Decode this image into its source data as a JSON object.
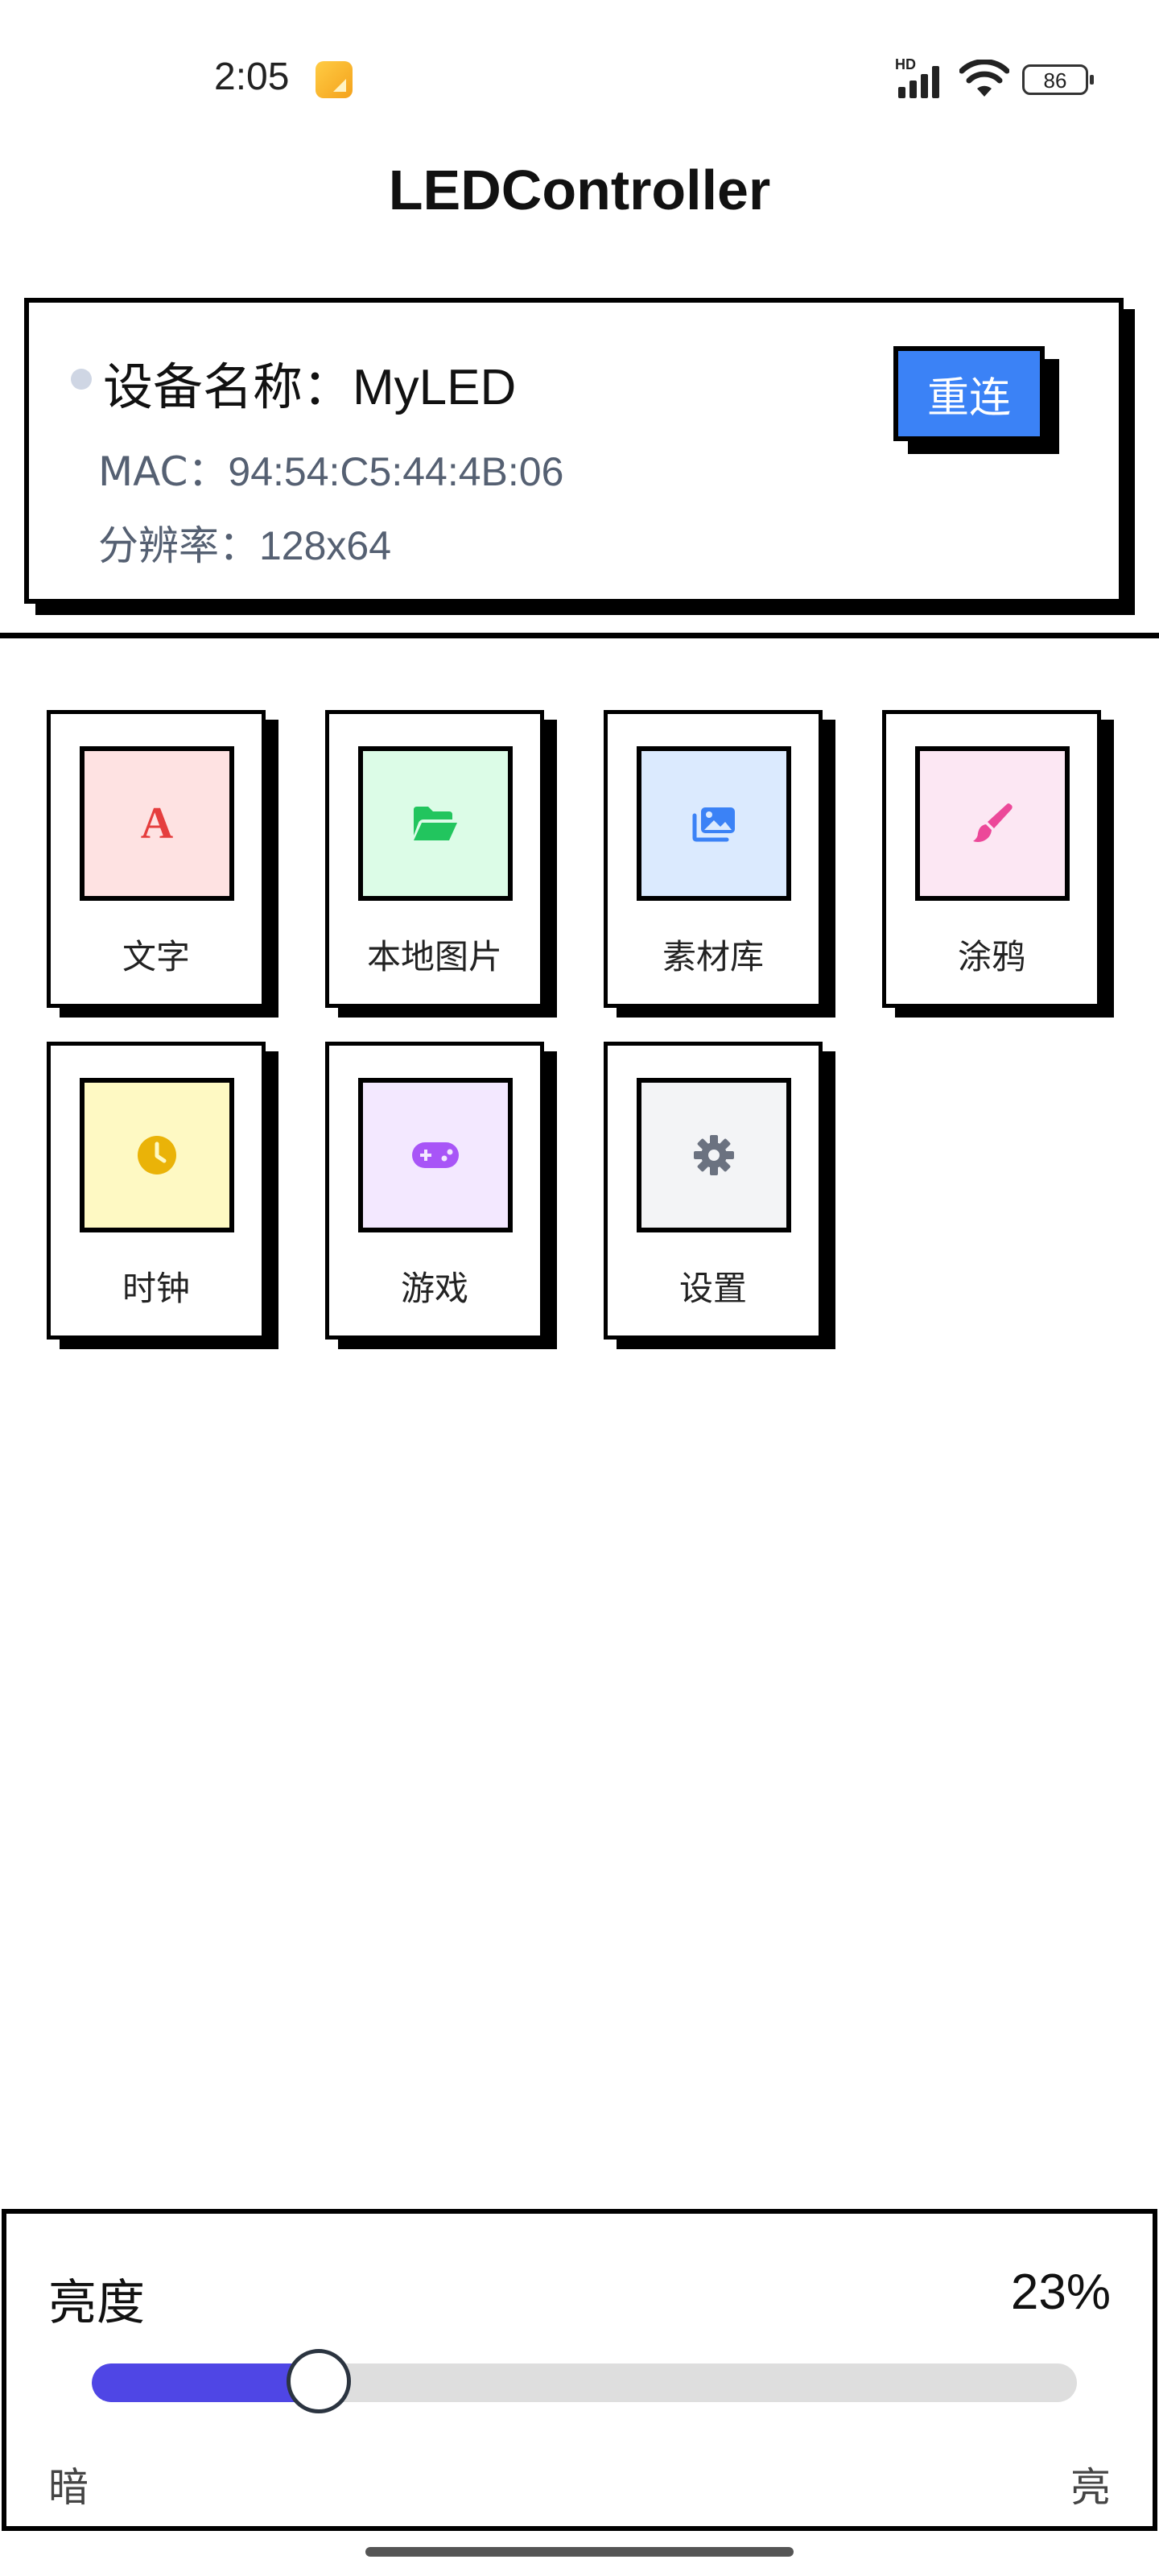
{
  "status_bar": {
    "time": "2:05",
    "signal_label": "HD",
    "battery": "86",
    "icons": [
      "note-app-icon",
      "signal-icon",
      "wifi-icon",
      "battery-icon"
    ]
  },
  "header": {
    "title": "LEDController"
  },
  "device": {
    "name_label": "设备名称：",
    "name": "MyLED",
    "mac_label": "MAC：",
    "mac": "94:54:C5:44:4B:06",
    "resolution_label": "分辨率：",
    "resolution": "128x64",
    "reconnect_label": "重连",
    "status_color": "#cfd6e4",
    "button_color": "#3b82f6"
  },
  "functions": [
    {
      "label": "文字",
      "icon": "text-icon",
      "bg": "#fee2e2",
      "fg": "#e53e3e"
    },
    {
      "label": "本地图片",
      "icon": "folder-open-icon",
      "bg": "#dcfce7",
      "fg": "#22c55e"
    },
    {
      "label": "素材库",
      "icon": "images-icon",
      "bg": "#dbeafe",
      "fg": "#3b82f6"
    },
    {
      "label": "涂鸦",
      "icon": "paintbrush-icon",
      "bg": "#fce7f3",
      "fg": "#ec4899"
    },
    {
      "label": "时钟",
      "icon": "clock-icon",
      "bg": "#fef9c3",
      "fg": "#eab308"
    },
    {
      "label": "游戏",
      "icon": "gamepad-icon",
      "bg": "#f3e8ff",
      "fg": "#a855f7"
    },
    {
      "label": "设置",
      "icon": "gear-icon",
      "bg": "#f3f4f6",
      "fg": "#6b7280"
    }
  ],
  "brightness": {
    "title": "亮度",
    "value_text": "23%",
    "value": 0.23,
    "min_label": "暗",
    "max_label": "亮",
    "fill_color": "#4f46e5"
  }
}
